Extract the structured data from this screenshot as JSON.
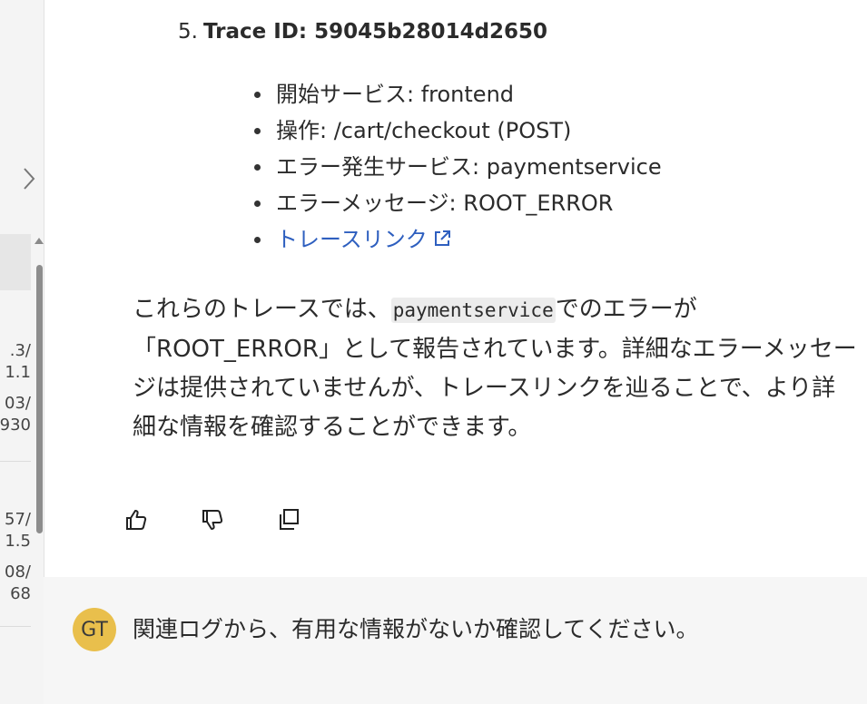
{
  "left_panel": {
    "fragments": [
      ".3/",
      "1.1",
      "03/",
      "930",
      "57/",
      "1.5",
      "08/",
      "68"
    ],
    "collapse_icon": "chevron-right-icon"
  },
  "message": {
    "item_number": "5.",
    "item_title": "Trace ID: 59045b28014d2650",
    "details": [
      "開始サービス: frontend",
      "操作: /cart/checkout (POST)",
      "エラー発生サービス: paymentservice",
      "エラーメッセージ: ROOT_ERROR"
    ],
    "trace_link": "トレースリンク",
    "paragraph_before_code": "これらのトレースでは、",
    "paragraph_code": "paymentservice",
    "paragraph_after_code": "でのエラーが「ROOT_ERROR」として報告されています。詳細なエラーメッセージは提供されていませんが、トレースリンクを辿ることで、より詳細な情報を確認することができます。"
  },
  "actions": {
    "like_icon": "thumbs-up-icon",
    "dislike_icon": "thumbs-down-icon",
    "copy_icon": "copy-icon"
  },
  "user_message": {
    "avatar_initials": "GT",
    "avatar_color": "#e9bf4c",
    "text": "関連ログから、有用な情報がないか確認してください。"
  },
  "colors": {
    "link": "#2e5fbf",
    "user_row_bg": "#f6f6f6"
  }
}
